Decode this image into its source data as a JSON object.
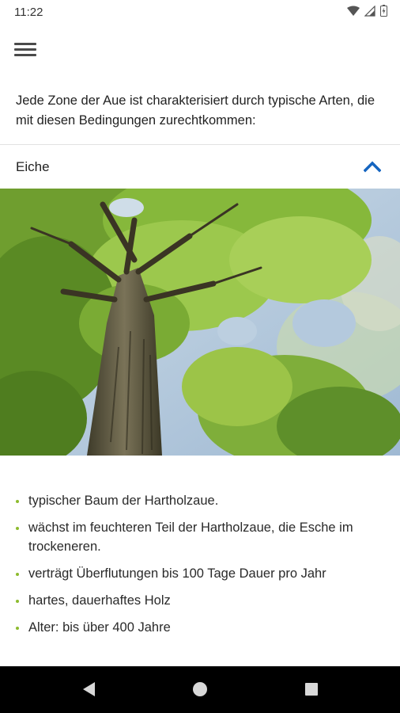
{
  "status_bar": {
    "time": "11:22",
    "icons": [
      "wifi-icon",
      "signal-icon",
      "battery-icon"
    ]
  },
  "app_bar": {
    "menu_icon": "hamburger-menu-icon"
  },
  "intro_text": "Jede Zone der Aue ist charakterisiert durch typische Arten, die mit diesen Bedingungen zurechtkommen:",
  "accordion": {
    "title": "Eiche",
    "expanded": true,
    "chevron_icon": "chevron-up-icon",
    "image_subject": "oak-tree-photo",
    "facts": [
      "typischer Baum der Hartholzaue.",
      "wächst im feuchteren Teil der Hartholzaue, die Esche im trockeneren.",
      "verträgt Überflutungen bis 100 Tage Dauer pro Jahr",
      "hartes, dauerhaftes Holz",
      "Alter: bis über 400 Jahre"
    ]
  },
  "colors": {
    "accent": "#1565c0",
    "bullet": "#8dbb2e",
    "nav_bar": "#000000"
  },
  "nav_bar": {
    "icons": [
      "back-icon",
      "home-icon",
      "recents-icon"
    ]
  }
}
